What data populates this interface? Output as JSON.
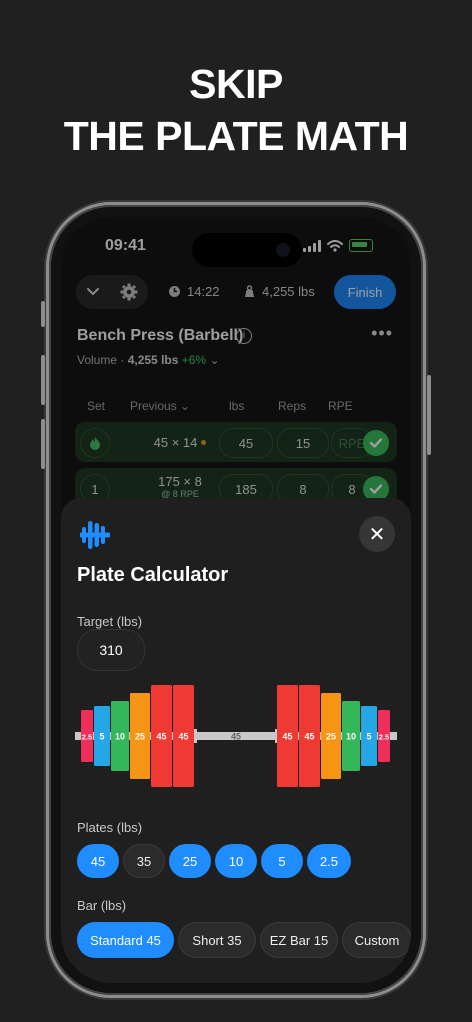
{
  "headline": {
    "line1": "SKIP",
    "line2": "THE PLATE MATH"
  },
  "status": {
    "time": "09:41"
  },
  "toolbar": {
    "timer": "14:22",
    "weight": "4,255 lbs",
    "finish_label": "Finish"
  },
  "exercise": {
    "title": "Bench Press (Barbell)",
    "info_glyph": "i",
    "more_glyph": "•••",
    "volume_prefix": "Volume ·",
    "volume_value": "4,255 lbs",
    "volume_change": "+6%",
    "volume_caret": "⌄"
  },
  "table": {
    "headers": {
      "set": "Set",
      "previous": "Previous ⌄",
      "unit": "lbs",
      "reps": "Reps",
      "rpe": "RPE"
    },
    "rows": [
      {
        "set_icon": "flame-icon",
        "previous": "45 × 14",
        "previous_sub": "",
        "lbs": "45",
        "reps": "15",
        "rpe": "RPE"
      },
      {
        "set": "1",
        "previous": "175 × 8",
        "previous_sub": "@ 8 RPE",
        "lbs": "185",
        "reps": "8",
        "rpe": "8"
      }
    ]
  },
  "plate_calculator": {
    "title": "Plate Calculator",
    "close_glyph": "✕",
    "target_label": "Target (lbs)",
    "target_value": "310",
    "plate_colors": {
      "45": "#ee3a33",
      "25": "#f69416",
      "10": "#34b75a",
      "5": "#27a6e6",
      "2.5": "#ee2f5c"
    },
    "bar_color": "#c8c8c8",
    "bar_label": "45",
    "left_plates": [
      "2.5",
      "5",
      "10",
      "25",
      "45",
      "45"
    ],
    "right_plates": [
      "45",
      "45",
      "25",
      "10",
      "5",
      "2.5"
    ],
    "plates_label": "Plates (lbs)",
    "plates": [
      {
        "value": "45",
        "selected": true
      },
      {
        "value": "35",
        "selected": false
      },
      {
        "value": "25",
        "selected": true
      },
      {
        "value": "10",
        "selected": true
      },
      {
        "value": "5",
        "selected": true
      },
      {
        "value": "2.5",
        "selected": true
      }
    ],
    "bar_section_label": "Bar (lbs)",
    "bars": [
      {
        "label": "Standard 45",
        "selected": true
      },
      {
        "label": "Short 35",
        "selected": false
      },
      {
        "label": "EZ Bar 15",
        "selected": false
      },
      {
        "label": "Custom",
        "selected": false
      }
    ]
  },
  "colors": {
    "accent": "#1f8cff",
    "success": "#3dbe5e",
    "background": "#202020"
  }
}
